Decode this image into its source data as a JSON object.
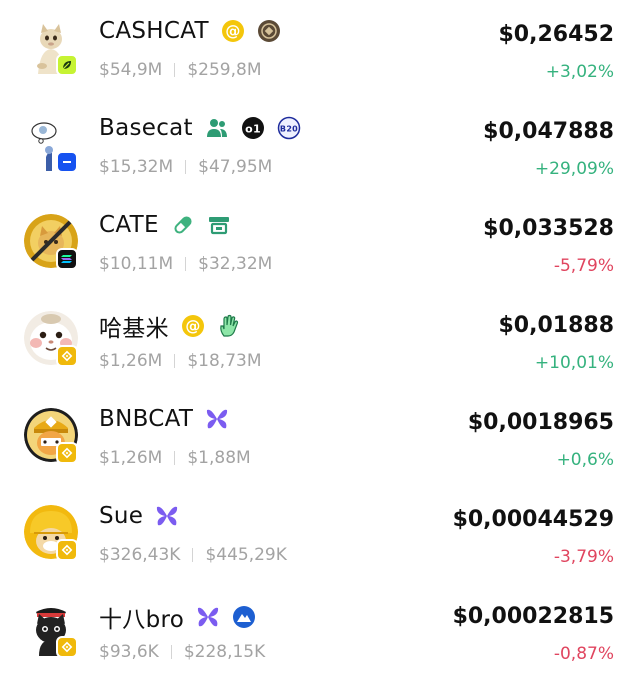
{
  "tokens": [
    {
      "name": "CASHCAT",
      "avatar_icon": "cat-meme-icon",
      "chain_icon": "leaf-chain-icon",
      "tag_icons": [
        "at-sign-icon",
        "dex-badge-icon"
      ],
      "market_cap": "$54,9M",
      "volume": "$259,8M",
      "price": "$0,26452",
      "change": "+3,02%",
      "direction": "up"
    },
    {
      "name": "Basecat",
      "avatar_icon": "thinking-cat-icon",
      "chain_icon": "base-chain-icon",
      "tag_icons": [
        "community-icon",
        "o1-badge-icon",
        "b20-badge-icon"
      ],
      "market_cap": "$15,32M",
      "volume": "$47,95M",
      "price": "$0,047888",
      "change": "+29,09%",
      "direction": "up"
    },
    {
      "name": "CATE",
      "avatar_icon": "gold-coin-cat-icon",
      "chain_icon": "solana-chain-icon",
      "tag_icons": [
        "pill-icon",
        "launchpad-icon"
      ],
      "market_cap": "$10,11M",
      "volume": "$32,32M",
      "price": "$0,033528",
      "change": "-5,79%",
      "direction": "down"
    },
    {
      "name": "哈基米",
      "avatar_icon": "hamster-cat-icon",
      "chain_icon": "bnb-chain-icon",
      "tag_icons": [
        "at-sign-icon",
        "hand-wave-icon"
      ],
      "market_cap": "$1,26M",
      "volume": "$18,73M",
      "price": "$0,01888",
      "change": "+10,01%",
      "direction": "up"
    },
    {
      "name": "BNBCAT",
      "avatar_icon": "bnb-hat-cat-icon",
      "chain_icon": "bnb-chain-icon",
      "tag_icons": [
        "butterfly-icon"
      ],
      "market_cap": "$1,26M",
      "volume": "$1,88M",
      "price": "$0,0018965",
      "change": "+0,6%",
      "direction": "up"
    },
    {
      "name": "Sue",
      "avatar_icon": "helmet-cat-icon",
      "chain_icon": "bnb-chain-icon",
      "tag_icons": [
        "butterfly-icon"
      ],
      "market_cap": "$326,43K",
      "volume": "$445,29K",
      "price": "$0,00044529",
      "change": "-3,79%",
      "direction": "down"
    },
    {
      "name": "十八bro",
      "avatar_icon": "black-cat-icon",
      "chain_icon": "bnb-chain-icon",
      "tag_icons": [
        "butterfly-icon",
        "mountain-badge-icon"
      ],
      "market_cap": "$93,6K",
      "volume": "$228,15K",
      "price": "$0,00022815",
      "change": "-0,87%",
      "direction": "down"
    }
  ],
  "colors": {
    "up": "#35b27e",
    "down": "#e0455f",
    "muted": "#a3a3a3",
    "bnb": "#f0b90b"
  }
}
